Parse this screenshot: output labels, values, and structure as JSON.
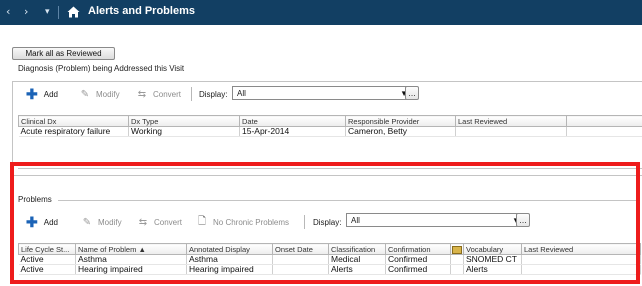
{
  "titlebar": {
    "nav_back": "‹",
    "nav_forward": "›",
    "nav_dropdown": "▾",
    "home_icon": "home-icon",
    "title": "Alerts and Problems",
    "background": "#123f63"
  },
  "mark_all_button": "Mark all as Reviewed",
  "diagnosis": {
    "section_label": "Diagnosis (Problem) being Addressed this Visit",
    "toolbar": {
      "add": "Add",
      "modify": "Modify",
      "convert": "Convert",
      "display_label": "Display:",
      "display_value": "All",
      "more": "..."
    },
    "columns": [
      "Clinical Dx",
      "Dx Type",
      "Date",
      "Responsible Provider",
      "Last Reviewed",
      ""
    ],
    "rows": [
      [
        "Acute respiratory failure",
        "Working",
        "15-Apr-2014",
        "Cameron, Betty",
        "",
        ""
      ]
    ]
  },
  "problems": {
    "section_label": "Problems",
    "toolbar": {
      "add": "Add",
      "modify": "Modify",
      "convert": "Convert",
      "no_chronic": "No Chronic Problems",
      "display_label": "Display:",
      "display_value": "All",
      "more": "..."
    },
    "columns": [
      "Life Cycle St...",
      "Name of Problem ▲",
      "Annotated Display",
      "Onset Date",
      "Classification",
      "Confirmation",
      "",
      "Vocabulary",
      "Last Reviewed"
    ],
    "rows": [
      [
        "Active",
        "Asthma",
        "Asthma",
        "",
        "Medical",
        "Confirmed",
        "",
        "SNOMED CT",
        ""
      ],
      [
        "Active",
        "Hearing impaired",
        "Hearing impaired",
        "",
        "Alerts",
        "Confirmed",
        "",
        "Alerts",
        ""
      ]
    ]
  },
  "highlight_color": "#ee1c1c"
}
